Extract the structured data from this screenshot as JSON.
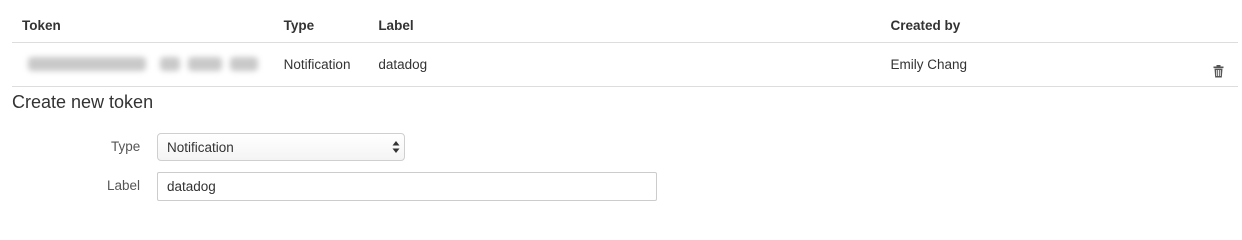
{
  "table": {
    "headers": {
      "token": "Token",
      "type": "Type",
      "label": "Label",
      "created_by": "Created by"
    },
    "rows": [
      {
        "type": "Notification",
        "label": "datadog",
        "created_by": "Emily Chang",
        "delete_icon": "trash-icon"
      }
    ]
  },
  "create": {
    "title": "Create new token",
    "type_label": "Type",
    "type_value": "Notification",
    "label_label": "Label",
    "label_value": "datadog"
  }
}
